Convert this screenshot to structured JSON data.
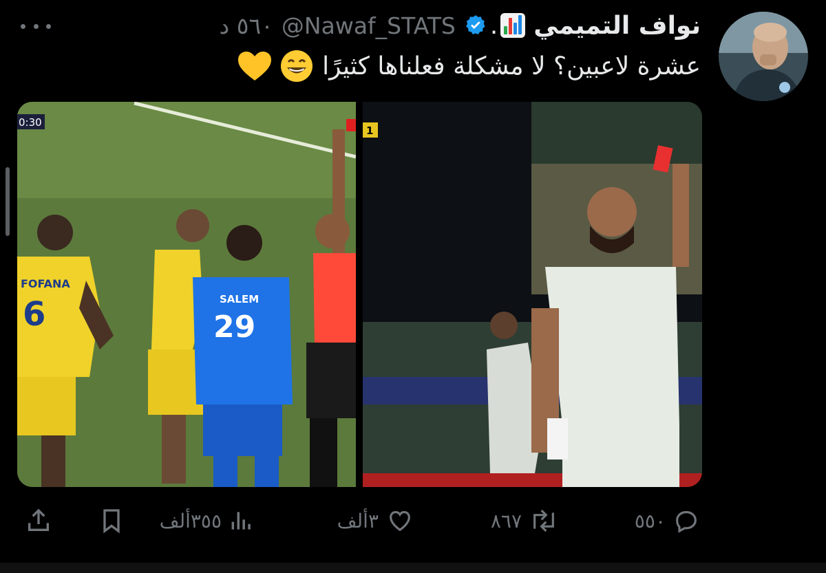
{
  "tweet": {
    "author_name": "نواف التميمي",
    "handle": "@Nawaf_STATS",
    "time": "٥٦٠ د",
    "text": "عشرة لاعبين؟ لا مشكلة فعلناها كثيرًا",
    "media": {
      "left_panel": {
        "clock": "0:30",
        "player_name": "SALEM",
        "player_number": "29",
        "opponent_name": "FOFANA",
        "opponent_number": "6"
      },
      "right_panel": {
        "score_bug": "1"
      }
    }
  },
  "actions": {
    "replies": "٥٥٠",
    "retweets": "٨٦٧",
    "likes": "٣ألف",
    "views": "٣٥٥ألف"
  },
  "icons": {
    "more": "more-icon",
    "verified": "verified-badge-icon",
    "chart_emoji": "bar-chart-emoji",
    "grin_emoji": "grinning-face-emoji",
    "heart_emoji": "yellow-heart-emoji",
    "reply": "reply-icon",
    "retweet": "retweet-icon",
    "like": "heart-icon",
    "views": "views-icon",
    "bookmark": "bookmark-icon",
    "share": "share-icon"
  },
  "colors": {
    "background": "#000000",
    "text": "#e7e9ea",
    "muted": "#71767b",
    "verified": "#1d9bf0",
    "nassr_yellow": "#f2d41c",
    "hilal_blue": "#1e6fe0",
    "referee_red": "#ff3b3b"
  }
}
